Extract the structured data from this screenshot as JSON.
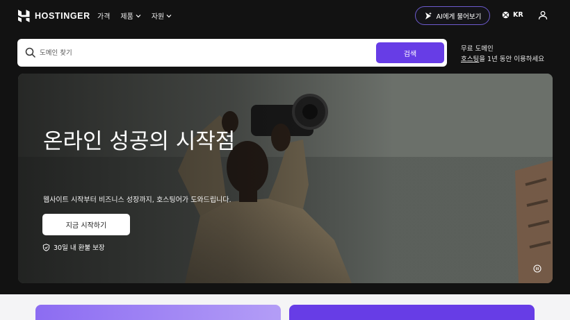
{
  "brand": {
    "name": "HOSTINGER",
    "logo_icon": "hostinger-logo-icon"
  },
  "nav": {
    "links": [
      {
        "label": "가격",
        "has_dropdown": false
      },
      {
        "label": "제품",
        "has_dropdown": true
      },
      {
        "label": "자원",
        "has_dropdown": true
      }
    ],
    "ai_button": "AI에게 물어보기",
    "language": "KR",
    "user_icon": "user-icon"
  },
  "search": {
    "placeholder": "도메인 찾기",
    "value": "",
    "button_label": "검색"
  },
  "domain_promo": {
    "title": "무료 도메인",
    "link_text": "호스팅",
    "rest_text": "을 1년 동안 이용하세요"
  },
  "hero": {
    "title": "온라인 성공의 시작점",
    "subtitle": "웹사이트 시작부터 비즈니스 성장까지, 호스팅어가 도와드립니다.",
    "cta_label": "지금 시작하기",
    "guarantee": "30일 내 환불 보장"
  },
  "colors": {
    "accent": "#673de6",
    "background": "#121212",
    "ai_border": "#6d5bd0"
  }
}
